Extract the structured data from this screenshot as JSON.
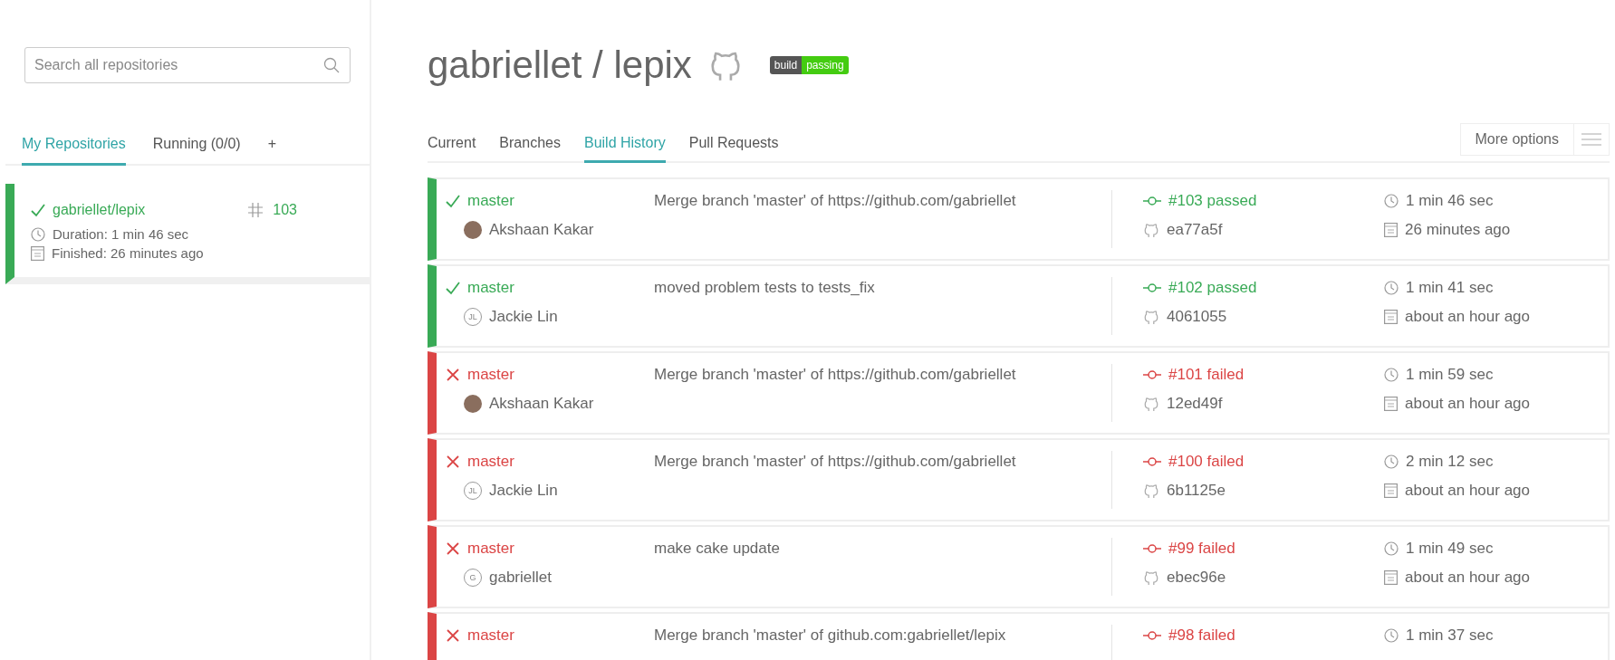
{
  "sidebar": {
    "search": {
      "placeholder": "Search all repositories"
    },
    "tabs": [
      {
        "label": "My Repositories",
        "selected": true
      },
      {
        "label": "Running (0/0)",
        "selected": false
      },
      {
        "label": "+",
        "selected": false
      }
    ],
    "repos": [
      {
        "name": "gabriellet/lepix",
        "kind": "success",
        "build_number": "103",
        "duration": "Duration: 1 min 46 sec",
        "finished": "Finished: 26 minutes ago"
      }
    ]
  },
  "header": {
    "title": "gabriellet / lepix",
    "badge": {
      "label": "build",
      "value": "passing"
    }
  },
  "tabs": [
    {
      "label": "Current",
      "selected": false
    },
    {
      "label": "Branches",
      "selected": false
    },
    {
      "label": "Build History",
      "selected": true
    },
    {
      "label": "Pull Requests",
      "selected": false
    }
  ],
  "more_options": "More options",
  "builds": [
    {
      "kind": "success",
      "branch": "master",
      "author": "Akshaan Kakar",
      "avatar": {
        "kind": "photo"
      },
      "message": "Merge branch 'master' of https://github.com/gabriellet",
      "build": "#103 passed",
      "commit": "ea77a5f",
      "duration": "1 min 46 sec",
      "finished": "26 minutes ago"
    },
    {
      "kind": "success",
      "branch": "master",
      "author": "Jackie Lin",
      "avatar": {
        "kind": "initials",
        "text": "JL"
      },
      "message": "moved problem tests to tests_fix",
      "build": "#102 passed",
      "commit": "4061055",
      "duration": "1 min 41 sec",
      "finished": "about an hour ago"
    },
    {
      "kind": "failure",
      "branch": "master",
      "author": "Akshaan Kakar",
      "avatar": {
        "kind": "photo"
      },
      "message": "Merge branch 'master' of https://github.com/gabriellet",
      "build": "#101 failed",
      "commit": "12ed49f",
      "duration": "1 min 59 sec",
      "finished": "about an hour ago"
    },
    {
      "kind": "failure",
      "branch": "master",
      "author": "Jackie Lin",
      "avatar": {
        "kind": "initials",
        "text": "JL"
      },
      "message": "Merge branch 'master' of https://github.com/gabriellet",
      "build": "#100 failed",
      "commit": "6b1125e",
      "duration": "2 min 12 sec",
      "finished": "about an hour ago"
    },
    {
      "kind": "failure",
      "branch": "master",
      "author": "gabriellet",
      "avatar": {
        "kind": "initials",
        "text": "G"
      },
      "message": "make cake update",
      "build": "#99 failed",
      "commit": "ebec96e",
      "duration": "1 min 49 sec",
      "finished": "about an hour ago"
    },
    {
      "kind": "failure",
      "branch": "master",
      "message": "Merge branch 'master' of github.com:gabriellet/lepix",
      "build": "#98 failed",
      "duration": "1 min 37 sec"
    }
  ]
}
